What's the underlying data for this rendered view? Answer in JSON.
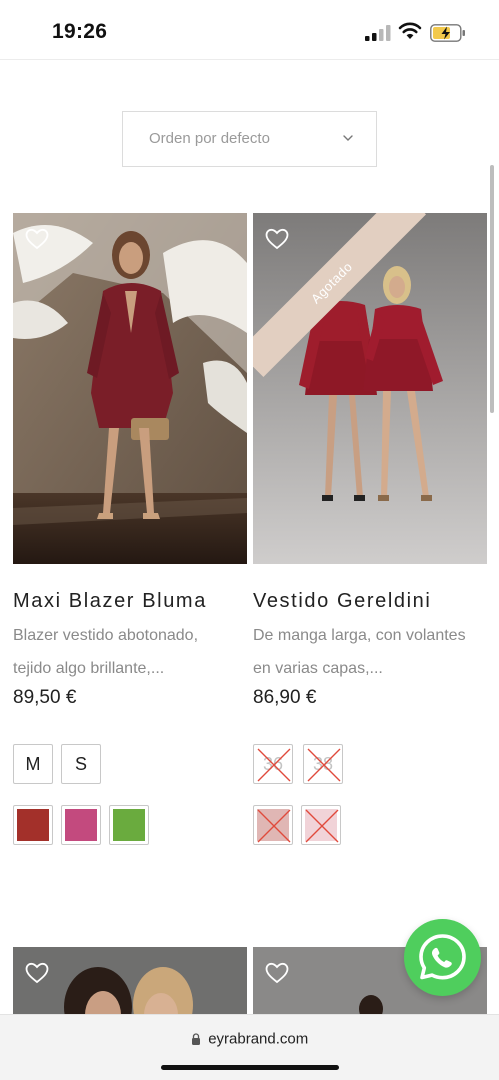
{
  "status_bar": {
    "time": "19:26"
  },
  "sort": {
    "label": "Orden por defecto"
  },
  "products": [
    {
      "name": "Maxi Blazer Bluma",
      "description_lines": [
        "Blazer vestido abotonado,",
        "tejido algo brillante,..."
      ],
      "price": "89,50 €",
      "sizes": [
        "M",
        "S"
      ],
      "colors": [
        "#a3302a",
        "#c34a7e",
        "#6aab3e"
      ],
      "sold_out": false
    },
    {
      "name": "Vestido Gereldini",
      "description_lines": [
        "De manga larga, con volantes",
        "en varias capas,..."
      ],
      "price": "86,90 €",
      "sizes": [
        "36",
        "38"
      ],
      "colors": [
        "#e0b6b4",
        "#f1d3d8"
      ],
      "sold_out": true,
      "badge": "Agotado"
    }
  ],
  "browser": {
    "url": "eyrabrand.com"
  }
}
